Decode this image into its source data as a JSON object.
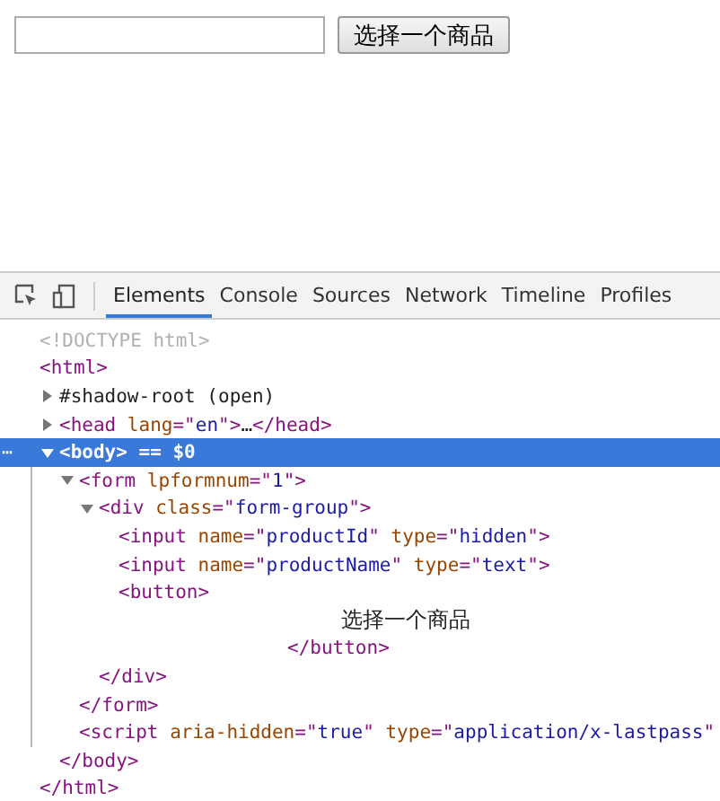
{
  "page": {
    "button": "选择一个商品"
  },
  "devtools": {
    "tabs": [
      {
        "label": "Elements",
        "selected": true
      },
      {
        "label": "Console",
        "selected": false
      },
      {
        "label": "Sources",
        "selected": false
      },
      {
        "label": "Network",
        "selected": false
      },
      {
        "label": "Timeline",
        "selected": false
      },
      {
        "label": "Profiles",
        "selected": false
      }
    ],
    "dom": [
      {
        "parts": [
          {
            "kind": "doctype",
            "text": "<!DOCTYPE html>"
          }
        ]
      },
      {
        "parts": [
          {
            "kind": "tag",
            "text": "<html>"
          }
        ],
        "children": [
          {
            "expanded": false,
            "parts": [
              {
                "kind": "plain",
                "text": "#shadow-root (open)"
              }
            ]
          },
          {
            "expanded": false,
            "parts": [
              {
                "kind": "tag",
                "text": "<head"
              },
              {
                "kind": "attr",
                "text": " lang"
              },
              {
                "kind": "tag",
                "text": "=\""
              },
              {
                "kind": "value",
                "text": "en"
              },
              {
                "kind": "tag",
                "text": "\">"
              },
              {
                "kind": "plain",
                "text": "…"
              },
              {
                "kind": "tag",
                "text": "</head>"
              }
            ]
          },
          {
            "expanded": true,
            "selected": true,
            "gutter": "⋯",
            "parts": [
              {
                "kind": "tag",
                "text": "<body>"
              },
              {
                "kind": "plain",
                "text": " == $0"
              }
            ],
            "children": [
              {
                "expanded": true,
                "parts": [
                  {
                    "kind": "tag",
                    "text": "<form"
                  },
                  {
                    "kind": "attr",
                    "text": " lpformnum"
                  },
                  {
                    "kind": "tag",
                    "text": "=\""
                  },
                  {
                    "kind": "value",
                    "text": "1"
                  },
                  {
                    "kind": "tag",
                    "text": "\">"
                  }
                ],
                "children": [
                  {
                    "expanded": true,
                    "parts": [
                      {
                        "kind": "tag",
                        "text": "<div"
                      },
                      {
                        "kind": "attr",
                        "text": " class"
                      },
                      {
                        "kind": "tag",
                        "text": "=\""
                      },
                      {
                        "kind": "value",
                        "text": "form-group"
                      },
                      {
                        "kind": "tag",
                        "text": "\">"
                      }
                    ],
                    "children": [
                      {
                        "parts": [
                          {
                            "kind": "tag",
                            "text": "<input"
                          },
                          {
                            "kind": "attr",
                            "text": " name"
                          },
                          {
                            "kind": "tag",
                            "text": "=\""
                          },
                          {
                            "kind": "value",
                            "text": "productId"
                          },
                          {
                            "kind": "tag",
                            "text": "\""
                          },
                          {
                            "kind": "attr",
                            "text": " type"
                          },
                          {
                            "kind": "tag",
                            "text": "=\""
                          },
                          {
                            "kind": "value",
                            "text": "hidden"
                          },
                          {
                            "kind": "tag",
                            "text": "\">"
                          }
                        ]
                      },
                      {
                        "parts": [
                          {
                            "kind": "tag",
                            "text": "<input"
                          },
                          {
                            "kind": "attr",
                            "text": " name"
                          },
                          {
                            "kind": "tag",
                            "text": "=\""
                          },
                          {
                            "kind": "value",
                            "text": "productName"
                          },
                          {
                            "kind": "tag",
                            "text": "\""
                          },
                          {
                            "kind": "attr",
                            "text": " type"
                          },
                          {
                            "kind": "tag",
                            "text": "=\""
                          },
                          {
                            "kind": "value",
                            "text": "text"
                          },
                          {
                            "kind": "tag",
                            "text": "\">"
                          }
                        ]
                      },
                      {
                        "parts": [
                          {
                            "kind": "tag",
                            "text": "<button>"
                          }
                        ],
                        "children": [
                          {
                            "kind": "text",
                            "parts": [
                              {
                                "kind": "plain",
                                "text": "选择一个商品"
                              }
                            ]
                          }
                        ],
                        "close": [
                          {
                            "kind": "tag",
                            "text": "</button>"
                          }
                        ]
                      }
                    ],
                    "close": [
                      {
                        "kind": "tag",
                        "text": "</div>"
                      }
                    ]
                  }
                ],
                "close": [
                  {
                    "kind": "tag",
                    "text": "</form>"
                  }
                ]
              },
              {
                "parts": [
                  {
                    "kind": "tag",
                    "text": "<script"
                  },
                  {
                    "kind": "attr",
                    "text": " aria-hidden"
                  },
                  {
                    "kind": "tag",
                    "text": "=\""
                  },
                  {
                    "kind": "value",
                    "text": "true"
                  },
                  {
                    "kind": "tag",
                    "text": "\""
                  },
                  {
                    "kind": "attr",
                    "text": " type"
                  },
                  {
                    "kind": "tag",
                    "text": "=\""
                  },
                  {
                    "kind": "value",
                    "text": "application/x-lastpass"
                  },
                  {
                    "kind": "tag",
                    "text": "\""
                  }
                ]
              }
            ],
            "close": [
              {
                "kind": "tag",
                "text": "</body>"
              }
            ]
          }
        ],
        "close": [
          {
            "kind": "tag",
            "text": "</html>"
          }
        ]
      }
    ]
  }
}
